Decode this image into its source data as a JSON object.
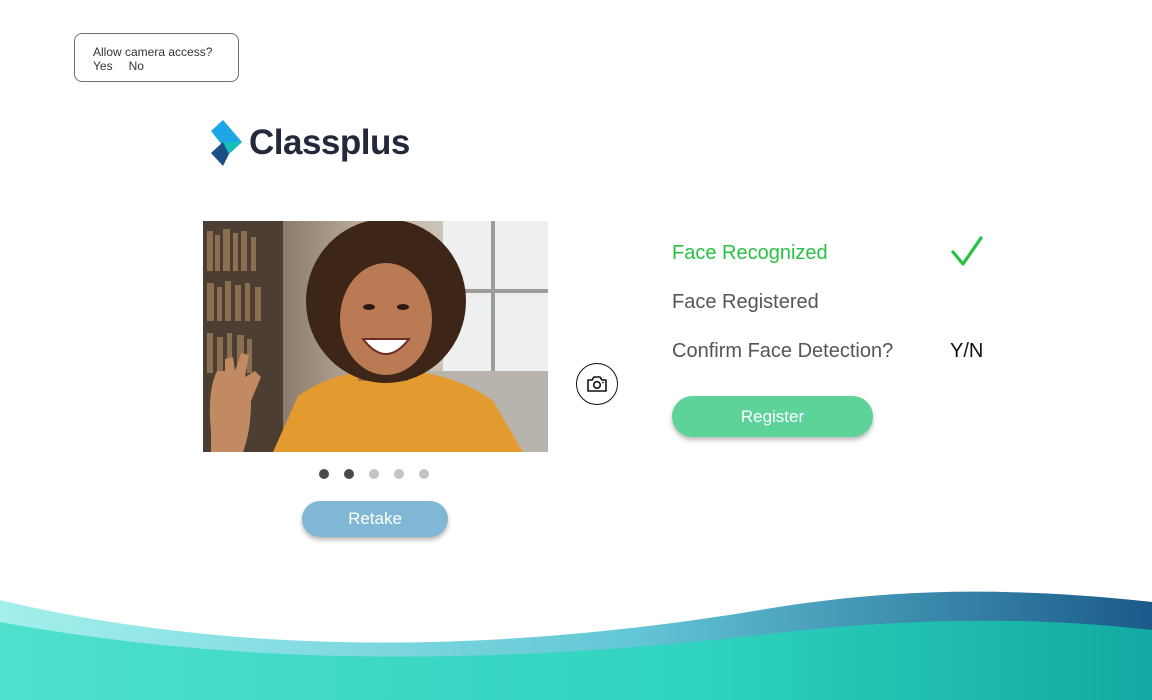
{
  "permission_prompt": {
    "question": "Allow camera access?",
    "yes_label": "Yes",
    "no_label": "No"
  },
  "brand": {
    "name": "Classplus",
    "logo_icon": "diamond-logo-icon",
    "logo_colors": [
      "#1ea6e6",
      "#1b4f86"
    ],
    "text_color": "#23283a"
  },
  "preview": {
    "image_description_icon": "user-photo",
    "carousel": {
      "total": 5,
      "active": [
        0,
        1
      ]
    }
  },
  "buttons": {
    "retake_label": "Retake",
    "register_label": "Register",
    "capture_icon": "camera-icon"
  },
  "status": {
    "recognized_label": "Face Recognized",
    "registered_label": "Face Registered",
    "confirm_label": "Confirm Face Detection?",
    "confirm_value": "Y/N",
    "check_icon": "checkmark-icon"
  },
  "colors": {
    "recognized_green": "#27c243",
    "retake_blue": "#7fb7d4",
    "register_green": "#5dd39a",
    "wave_teal": "#2fd3bf",
    "wave_navy": "#1b5a8a"
  }
}
